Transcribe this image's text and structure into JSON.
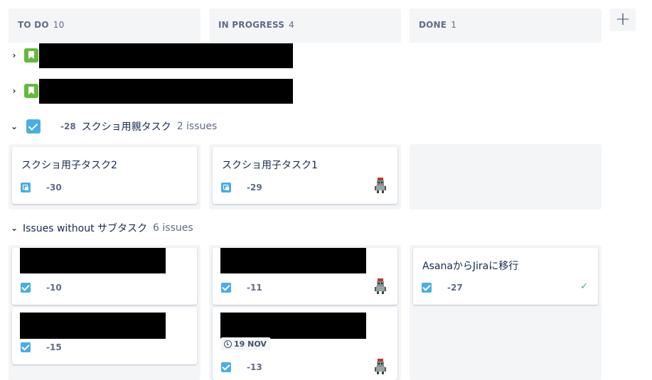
{
  "columns": [
    {
      "name": "TO DO",
      "count": "10"
    },
    {
      "name": "IN PROGRESS",
      "count": "4"
    },
    {
      "name": "DONE",
      "count": "1"
    }
  ],
  "add_column": "+",
  "epic_rows": [
    {
      "chevron": "›"
    },
    {
      "chevron": "›"
    }
  ],
  "parent": {
    "chevron": "⌄",
    "key": "-28",
    "title": "スクショ用親タスク",
    "issue_count": "2 issues",
    "cards": [
      {
        "title": "スクショ用子タスク2",
        "key": "-30",
        "icon": "subtask-icon"
      },
      {
        "title": "スクショ用子タスク1",
        "key": "-29",
        "icon": "subtask-icon",
        "avatar": "robot-avatar"
      }
    ]
  },
  "without": {
    "chevron": "⌄",
    "title": "Issues without サブタスク",
    "issue_count": "6 issues",
    "todo_cards": [
      {
        "key": "-10",
        "icon": "task-icon"
      },
      {
        "key": "-15",
        "icon": "task-icon"
      }
    ],
    "progress_cards": [
      {
        "key": "-11",
        "icon": "task-icon",
        "avatar": "robot-avatar"
      },
      {
        "key": "-13",
        "icon": "task-icon",
        "due": "19 NOV",
        "avatar": "robot-avatar"
      }
    ],
    "done_cards": [
      {
        "title": "AsanaからJiraに移行",
        "key": "-27",
        "icon": "task-icon",
        "status": "✓"
      }
    ]
  },
  "colors": {
    "header_bg": "#f4f5f7",
    "story": "#63ba3c",
    "task": "#4bade8",
    "done": "#36b37e"
  }
}
